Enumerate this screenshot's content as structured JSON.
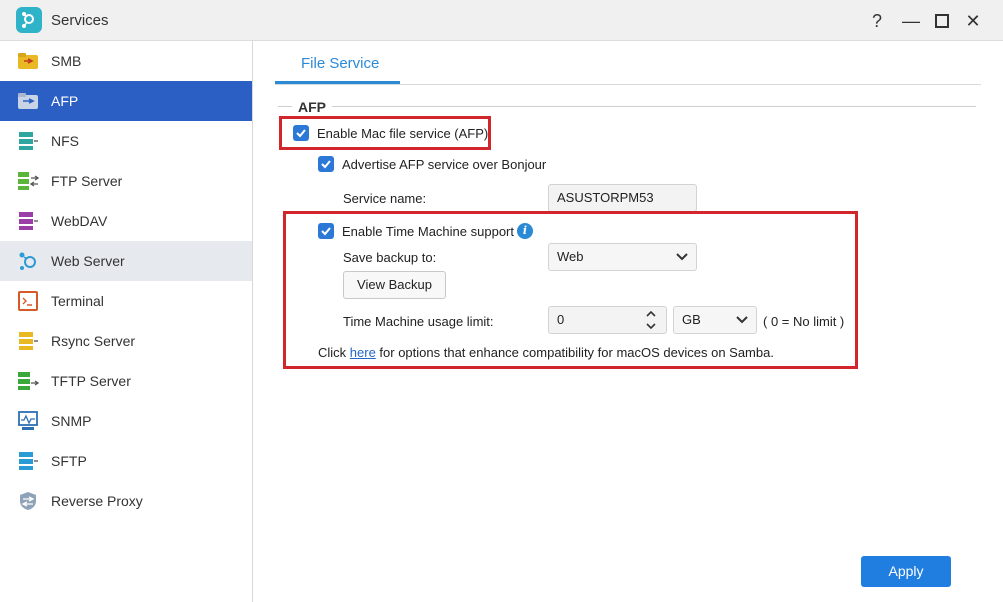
{
  "window": {
    "title": "Services",
    "help_glyph": "?",
    "minimize_glyph": "—",
    "close_glyph": "✕"
  },
  "sidebar": {
    "items": [
      {
        "label": "SMB",
        "icon": "smb-folder-icon"
      },
      {
        "label": "AFP",
        "icon": "afp-folder-icon",
        "active": true
      },
      {
        "label": "NFS",
        "icon": "nfs-icon"
      },
      {
        "label": "FTP Server",
        "icon": "ftp-server-icon"
      },
      {
        "label": "WebDAV",
        "icon": "webdav-icon"
      },
      {
        "label": "Web Server",
        "icon": "web-server-icon",
        "hover": true
      },
      {
        "label": "Terminal",
        "icon": "terminal-icon"
      },
      {
        "label": "Rsync Server",
        "icon": "rsync-icon"
      },
      {
        "label": "TFTP Server",
        "icon": "tftp-icon"
      },
      {
        "label": "SNMP",
        "icon": "snmp-icon"
      },
      {
        "label": "SFTP",
        "icon": "sftp-icon"
      },
      {
        "label": "Reverse Proxy",
        "icon": "reverse-proxy-shield-icon"
      }
    ]
  },
  "tabs": [
    {
      "label": "File Service",
      "active": true
    }
  ],
  "afp": {
    "section_title": "AFP",
    "enable_afp": {
      "label": "Enable Mac file service (AFP)",
      "checked": true
    },
    "bonjour": {
      "label": "Advertise AFP service over Bonjour",
      "checked": true
    },
    "service_name": {
      "label": "Service name:",
      "value": "ASUSTORPM53"
    },
    "time_machine": {
      "label": "Enable Time Machine support",
      "checked": true,
      "info_glyph": "i"
    },
    "save_backup": {
      "label": "Save backup to:",
      "value": "Web"
    },
    "view_backup_button": "View Backup",
    "usage_limit": {
      "label": "Time Machine usage limit:",
      "value": "0",
      "unit": "GB",
      "hint": "( 0 = No limit )"
    },
    "samba_note": {
      "prefix": "Click ",
      "link": "here",
      "suffix": " for options that enhance compatibility for macOS devices on Samba."
    }
  },
  "footer": {
    "apply_button": "Apply"
  },
  "colors": {
    "accent": "#2b8ad6",
    "active_sidebar": "#2b5fc3",
    "highlight_red": "#d2262d",
    "primary_button": "#1f7ee0"
  }
}
